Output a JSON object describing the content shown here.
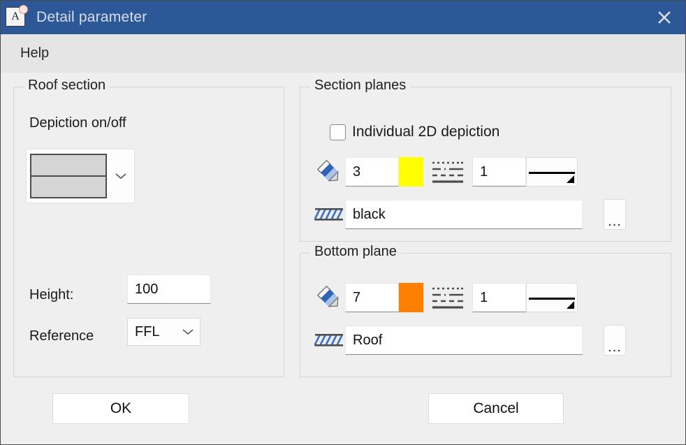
{
  "window": {
    "title": "Detail parameter",
    "app_icon": "document-a-icon",
    "close_icon": "close-icon"
  },
  "menubar": {
    "items": [
      {
        "label": "Help",
        "name": "menu-item-help"
      }
    ]
  },
  "roof_section": {
    "group_title": "Roof section",
    "depiction_label": "Depiction on/off",
    "depiction_combo": {
      "icon": "two-layer-section-preview",
      "chevron": "chevron-down-icon"
    },
    "height_label": "Height:",
    "height_value": "100",
    "reference_label": "Reference",
    "reference_value": "FFL",
    "reference_chevron": "chevron-down-icon"
  },
  "section_planes": {
    "group_title": "Section planes",
    "individual_2d_label": "Individual 2D depiction",
    "individual_2d_checked": false,
    "pen_icon": "pencil-icon",
    "pen_value": "3",
    "pen_color": "#ffff00",
    "linetype_icon": "line-type-icon",
    "linetype_value": "1",
    "lineweight_icon": "line-weight-preview-icon",
    "hatch_icon": "hatch-pattern-icon",
    "hatch_value": "black",
    "browse_label": "...",
    "browse_icon": "ellipsis-icon"
  },
  "bottom_plane": {
    "group_title": "Bottom plane",
    "pen_icon": "pencil-icon",
    "pen_value": "7",
    "pen_color": "#ff7f00",
    "linetype_icon": "line-type-icon",
    "linetype_value": "1",
    "lineweight_icon": "line-weight-preview-icon",
    "hatch_icon": "hatch-pattern-icon",
    "hatch_value": "Roof",
    "browse_label": "...",
    "browse_icon": "ellipsis-icon"
  },
  "footer": {
    "ok_label": "OK",
    "cancel_label": "Cancel"
  },
  "theme": {
    "titlebar_bg": "#2c5898",
    "dialog_bg": "#efefef",
    "menubar_bg": "#e5e5e5"
  }
}
